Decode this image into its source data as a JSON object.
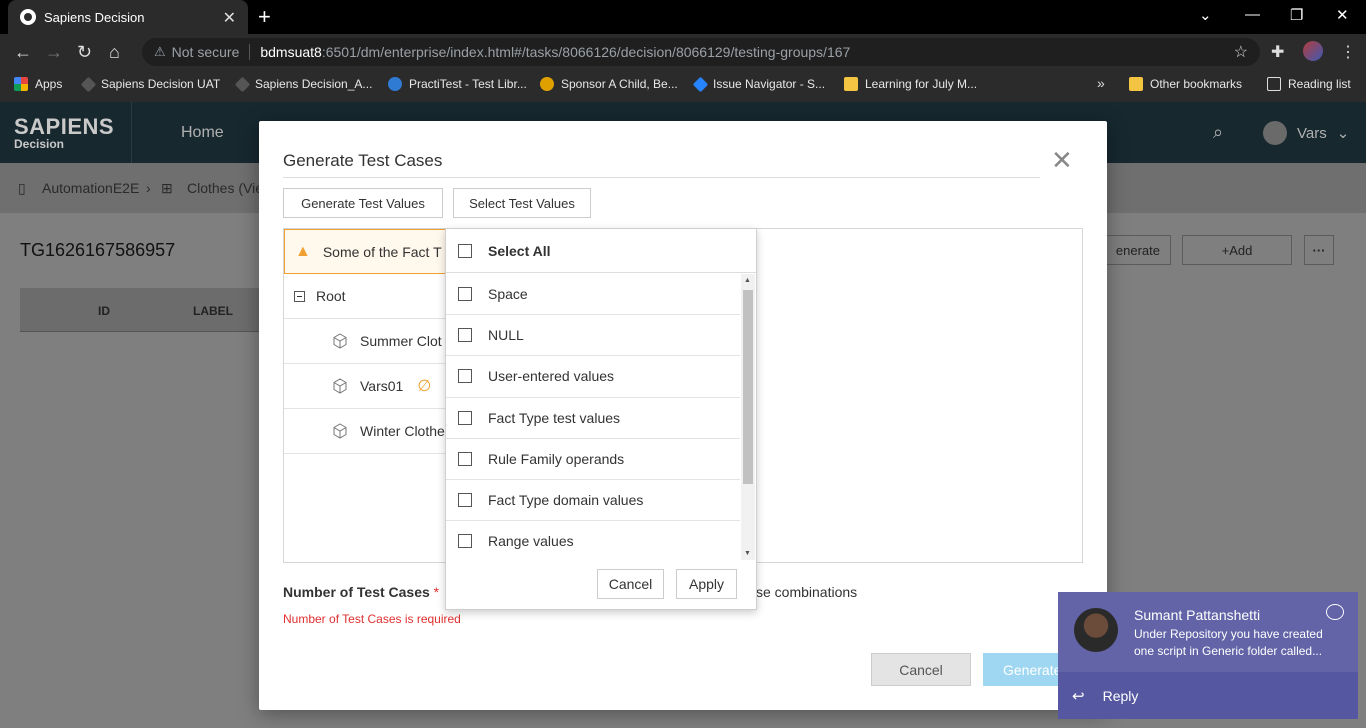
{
  "browser": {
    "tab_title": "Sapiens Decision",
    "url_warning": "Not secure",
    "url_host": "bdmsuat8",
    "url_path": ":6501/dm/enterprise/index.html#/tasks/8066126/decision/8066129/testing-groups/167",
    "bookmarks": [
      {
        "label": "Apps",
        "icon": "apps-grid-icon",
        "color": "#e8453c"
      },
      {
        "label": "Sapiens Decision UAT",
        "icon": "site-icon",
        "color": "#555555"
      },
      {
        "label": "Sapiens Decision_A...",
        "icon": "site-icon",
        "color": "#555555"
      },
      {
        "label": "PractiTest - Test Libr...",
        "icon": "practitest-icon",
        "color": "#2f7bd3"
      },
      {
        "label": "Sponsor A Child, Be...",
        "icon": "sponsor-icon",
        "color": "#e0a000"
      },
      {
        "label": "Issue Navigator - S...",
        "icon": "jira-icon",
        "color": "#2684ff"
      },
      {
        "label": "Learning for July M...",
        "icon": "folder-icon",
        "color": "#f4c542"
      }
    ],
    "other_bookmarks": "Other bookmarks",
    "reading_list": "Reading list"
  },
  "app": {
    "logo": "SAPIENS",
    "logo_sub": "Decision",
    "nav_home": "Home",
    "user_name": "Vars",
    "breadcrumb_1": "AutomationE2E",
    "breadcrumb_2": "Clothes (Vie",
    "page_id": "TG1626167586957",
    "grid_col_id": "ID",
    "grid_col_label": "LABEL",
    "btn_generate_bg": "enerate",
    "btn_add_bg": "+Add",
    "btn_more_bg": "···"
  },
  "modal": {
    "title": "Generate Test Cases",
    "btn_generate_values": "Generate Test Values",
    "btn_select_values": "Select Test Values",
    "warning_text": "Some of the Fact T",
    "tree": {
      "root": "Root",
      "items": [
        "Summer Clot",
        "Vars01",
        "Winter Clothe"
      ]
    },
    "num_cases_label": "Number of Test Cases",
    "required_mark": "*",
    "num_cases_error": "Number of Test Cases is required",
    "pairwise_text": "se combinations",
    "cancel": "Cancel",
    "generate": "Generate"
  },
  "dropdown": {
    "select_all": "Select All",
    "options": [
      "Space",
      "NULL",
      "User-entered values",
      "Fact Type test values",
      "Rule Family operands",
      "Fact Type domain values",
      "Range values"
    ],
    "cancel": "Cancel",
    "apply": "Apply"
  },
  "toast": {
    "sender": "Sumant Pattanshetti",
    "message": "Under Repository you have created one script in Generic folder called...",
    "reply": "Reply",
    "accent": "#6264a7"
  }
}
